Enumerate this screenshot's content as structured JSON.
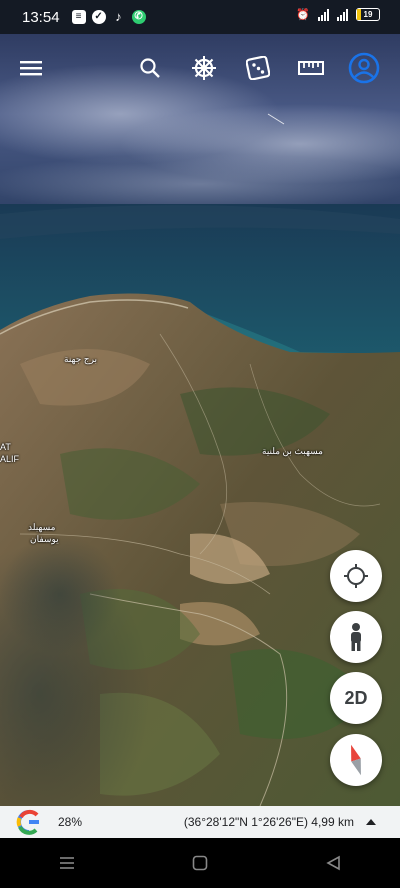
{
  "status_bar": {
    "time": "13:54",
    "battery": "19",
    "app_icons": [
      "notes-icon",
      "messenger-icon",
      "tiktok-icon",
      "whatsapp-icon"
    ]
  },
  "toolbar": {
    "items": [
      "menu-icon",
      "search-icon",
      "voyager-icon",
      "feeling-lucky-dice-icon",
      "measure-icon",
      "account-icon"
    ]
  },
  "map": {
    "labels": [
      {
        "text": "برج جهنة"
      },
      {
        "text": "مسهبث بن ملنية"
      },
      {
        "text": "AT"
      },
      {
        "text": "ALIF"
      },
      {
        "text": "مسهبلد"
      },
      {
        "text": "يوسفان"
      }
    ]
  },
  "fab": {
    "location_icon": "my-location-icon",
    "pegman_icon": "pegman-icon",
    "view_toggle_label": "2D",
    "compass_icon": "compass-icon"
  },
  "info_bar": {
    "zoom_level": "28%",
    "coordinates": "(36°28'12\"N 1°26'26\"E) 4,99 km"
  },
  "colors": {
    "accent_blue": "#4285f4",
    "account_ring": "#1a73e8",
    "sea": "#1d4a64",
    "terrain": "#6b5a42"
  }
}
